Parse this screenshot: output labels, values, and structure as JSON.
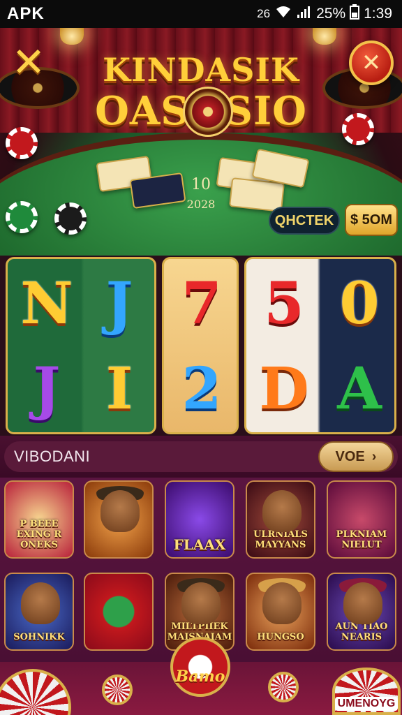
{
  "status_bar": {
    "app_name": "APK",
    "network": "26",
    "battery": "25%",
    "time": "1:39"
  },
  "header": {
    "close_left_icon": "x-icon",
    "close_right_icon": "close-icon",
    "logo_line1": "KINDASIK",
    "logo_line2": "OASOSIO"
  },
  "table": {
    "center_number": "10",
    "center_year": "2028",
    "checkout_label": "QHCTEK",
    "balance_label": "$ 5OM"
  },
  "reels": {
    "reel1": [
      "N",
      "J",
      "J",
      "I"
    ],
    "reel2": [
      "7",
      "2"
    ],
    "reel3": [
      "5",
      "0",
      "D",
      "A"
    ]
  },
  "section": {
    "title": "VIBODANI",
    "more_label": "VOE",
    "more_icon": "chevron-right-icon"
  },
  "games": [
    {
      "title": "P BEEE EXING R ONEKS"
    },
    {
      "title": ""
    },
    {
      "title": "FLAAX"
    },
    {
      "title": "ULRNIALS MAYYANS"
    },
    {
      "title": "PLKNIAM NIELUT"
    },
    {
      "title": "SOHNIKK"
    },
    {
      "title": ""
    },
    {
      "title": "MILTPIIEK MAISNAIAM"
    },
    {
      "title": "HUNGSO"
    },
    {
      "title": "AUN TIAO NEARIS"
    }
  ],
  "bottom": {
    "center_label": "Bamo",
    "right_label": "UMENOYG"
  },
  "colors": {
    "felt": "#2f7f3d",
    "curtain": "#8f1a24",
    "gold": "#ffcf3a",
    "panel": "#4a0f34"
  }
}
